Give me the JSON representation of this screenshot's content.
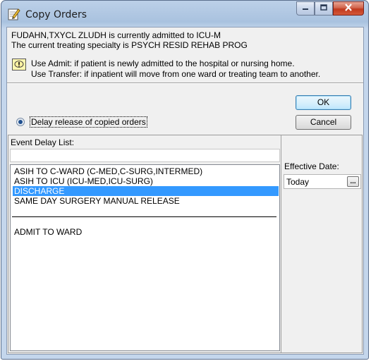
{
  "window": {
    "title": "Copy Orders",
    "icon": "edit-document-icon"
  },
  "info": {
    "line1": "FUDAHN,TXYCL ZLUDH is currently admitted to ICU-M",
    "line2": "The current treating specialty is PSYCH RESID REHAB PROG"
  },
  "notes": {
    "icon": "info-exclamation-icon",
    "line1": "Use Admit: if patient is newly admitted to the hospital or nursing home.",
    "line2": "Use Transfer: if inpatient will move from one ward or treating team to another."
  },
  "buttons": {
    "ok": "OK",
    "cancel": "Cancel"
  },
  "delay_option": {
    "label": "Delay release of copied orders",
    "checked": true
  },
  "event_delay": {
    "label": "Event Delay List:",
    "filter_value": "",
    "items": [
      "ASIH TO C-WARD (C-MED,C-SURG,INTERMED)",
      "ASIH TO ICU (ICU-MED,ICU-SURG)",
      "DISCHARGE",
      "SAME DAY SURGERY MANUAL RELEASE"
    ],
    "selected": "DISCHARGE",
    "items_after_separator": [
      "ADMIT TO WARD"
    ]
  },
  "effective_date": {
    "label": "Effective Date:",
    "value": "Today",
    "button": "..."
  },
  "colors": {
    "selection": "#3399ff",
    "close_button": "#c1391d"
  }
}
